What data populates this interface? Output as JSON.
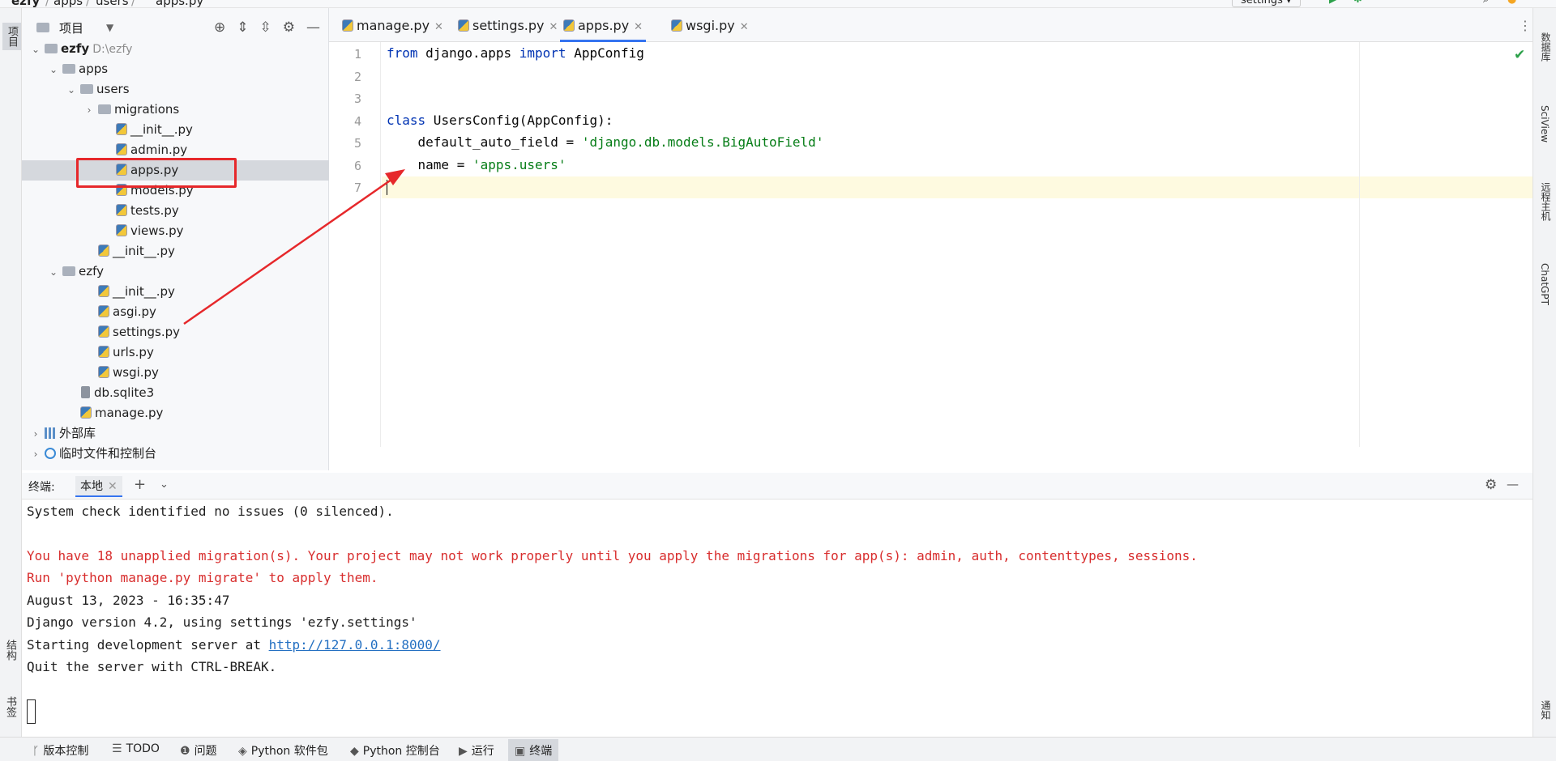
{
  "breadcrumb": [
    "ezfy",
    "apps",
    "users",
    "apps.py"
  ],
  "run_config": "settings",
  "left_strip": {
    "project_label": "项目",
    "structure_label": "结构",
    "bookmarks_label": "书签"
  },
  "right_strip": {
    "database": "数据库",
    "sciview": "SciView",
    "remote_host": "远程主机",
    "chatgpt": "ChatGPT",
    "notifications": "通知"
  },
  "project_panel": {
    "title": "项目",
    "tree": [
      {
        "label": "ezfy",
        "extra": "D:\\ezfy",
        "type": "folder",
        "expanded": true
      },
      {
        "label": "apps",
        "type": "folder",
        "expanded": true
      },
      {
        "label": "users",
        "type": "folder",
        "expanded": true
      },
      {
        "label": "migrations",
        "type": "folder",
        "expanded": false
      },
      {
        "label": "__init__.py",
        "type": "py"
      },
      {
        "label": "admin.py",
        "type": "py"
      },
      {
        "label": "apps.py",
        "type": "py",
        "selected": true
      },
      {
        "label": "models.py",
        "type": "py"
      },
      {
        "label": "tests.py",
        "type": "py"
      },
      {
        "label": "views.py",
        "type": "py"
      },
      {
        "label": "__init__.py",
        "type": "py"
      },
      {
        "label": "ezfy",
        "type": "folder",
        "expanded": true
      },
      {
        "label": "__init__.py",
        "type": "py"
      },
      {
        "label": "asgi.py",
        "type": "py"
      },
      {
        "label": "settings.py",
        "type": "py"
      },
      {
        "label": "urls.py",
        "type": "py"
      },
      {
        "label": "wsgi.py",
        "type": "py"
      },
      {
        "label": "db.sqlite3",
        "type": "db"
      },
      {
        "label": "manage.py",
        "type": "py"
      },
      {
        "label": "外部库",
        "type": "lib",
        "expanded": false
      },
      {
        "label": "临时文件和控制台",
        "type": "scratch",
        "expanded": false
      }
    ]
  },
  "editor": {
    "tabs": [
      {
        "label": "manage.py"
      },
      {
        "label": "settings.py"
      },
      {
        "label": "apps.py",
        "active": true
      },
      {
        "label": "wsgi.py"
      }
    ],
    "line_numbers": [
      "1",
      "2",
      "3",
      "4",
      "5",
      "6",
      "7"
    ],
    "code": {
      "l1_kw1": "from",
      "l1_mod": " django.apps ",
      "l1_kw2": "import",
      "l1_name": " AppConfig",
      "l4_kw": "class",
      "l4_rest": " UsersConfig(AppConfig):",
      "l5_pre": "    default_auto_field = ",
      "l5_str": "'django.db.models.BigAutoField'",
      "l6_pre": "    name = ",
      "l6_str": "'apps.users'"
    }
  },
  "terminal": {
    "label": "终端:",
    "tab": "本地",
    "lines": {
      "l1": "System check identified no issues (0 silenced).",
      "l2": "You have 18 unapplied migration(s). Your project may not work properly until you apply the migrations for app(s): admin, auth, contenttypes, sessions.",
      "l3": "Run 'python manage.py migrate' to apply them.",
      "l4": "August 13, 2023 - 16:35:47",
      "l5": "Django version 4.2, using settings 'ezfy.settings'",
      "l6_pre": "Starting development server at ",
      "l6_link": "http://127.0.0.1:8000/",
      "l7": "Quit the server with CTRL-BREAK."
    }
  },
  "bottom_bar": {
    "vcs": "版本控制",
    "todo": "TODO",
    "problems": "问题",
    "python_packages": "Python 软件包",
    "python_console": "Python 控制台",
    "run": "运行",
    "terminal": "终端"
  },
  "colors": {
    "annotation_red": "#e6282b",
    "keyword": "#0033b3",
    "string": "#067d17",
    "error_text": "#d82d2d",
    "accent": "#3574f0"
  }
}
